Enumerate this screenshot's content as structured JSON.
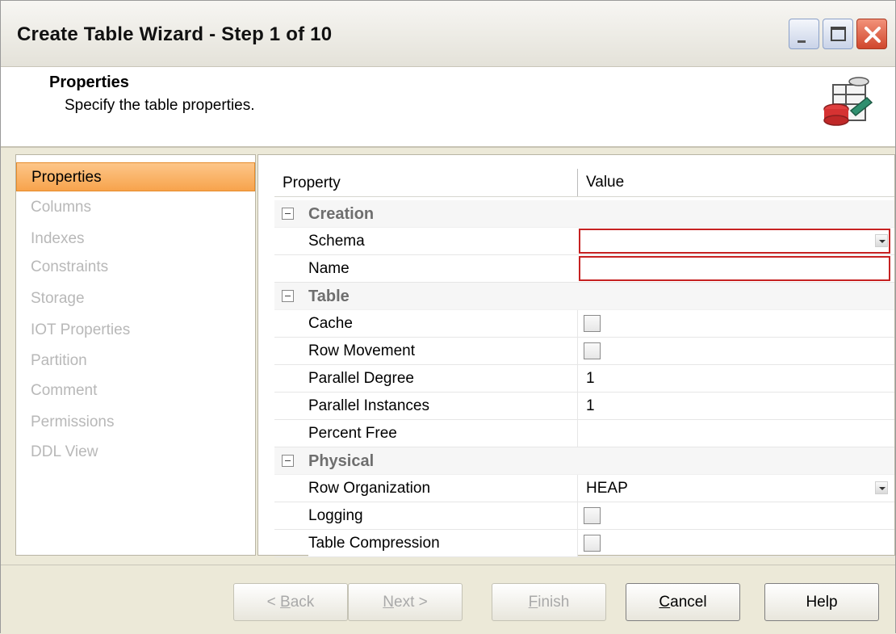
{
  "window": {
    "title": "Create Table Wizard - Step 1 of 10"
  },
  "header": {
    "title": "Properties",
    "subtitle": "Specify the table properties."
  },
  "nav": {
    "items": [
      {
        "label": "Properties",
        "active": true
      },
      {
        "label": "Columns",
        "active": false
      },
      {
        "label": "Indexes",
        "active": false
      },
      {
        "label": "Constraints",
        "active": false
      },
      {
        "label": "Storage",
        "active": false
      },
      {
        "label": "IOT Properties",
        "active": false
      },
      {
        "label": "Partition",
        "active": false
      },
      {
        "label": "Comment",
        "active": false
      },
      {
        "label": "Permissions",
        "active": false
      },
      {
        "label": "DDL View",
        "active": false
      }
    ]
  },
  "grid": {
    "col_property": "Property",
    "col_value": "Value",
    "categories": {
      "creation": "Creation",
      "table": "Table",
      "physical": "Physical"
    },
    "rows": {
      "schema": {
        "label": "Schema",
        "value": ""
      },
      "name": {
        "label": "Name",
        "value": ""
      },
      "cache": {
        "label": "Cache",
        "checked": false
      },
      "row_movement": {
        "label": "Row Movement",
        "checked": false
      },
      "parallel_degree": {
        "label": "Parallel Degree",
        "value": "1"
      },
      "parallel_instances": {
        "label": "Parallel Instances",
        "value": "1"
      },
      "percent_free": {
        "label": "Percent Free",
        "value": ""
      },
      "row_organization": {
        "label": "Row Organization",
        "value": "HEAP"
      },
      "logging": {
        "label": "Logging",
        "checked": false
      },
      "table_compression": {
        "label": "Table Compression",
        "checked": false
      }
    }
  },
  "buttons": {
    "back": {
      "mnemonic": "B",
      "rest": "ack",
      "prefix": "< ",
      "enabled": false
    },
    "next": {
      "mnemonic": "N",
      "rest": "ext >",
      "enabled": false
    },
    "finish": {
      "mnemonic": "F",
      "rest": "inish",
      "enabled": false
    },
    "cancel": {
      "mnemonic": "C",
      "rest": "ancel",
      "enabled": true
    },
    "help": {
      "label": "Help",
      "enabled": true
    }
  },
  "colors": {
    "active_nav": "#f7a34c",
    "error_border": "#c62222",
    "close_button": "#d0472c"
  }
}
